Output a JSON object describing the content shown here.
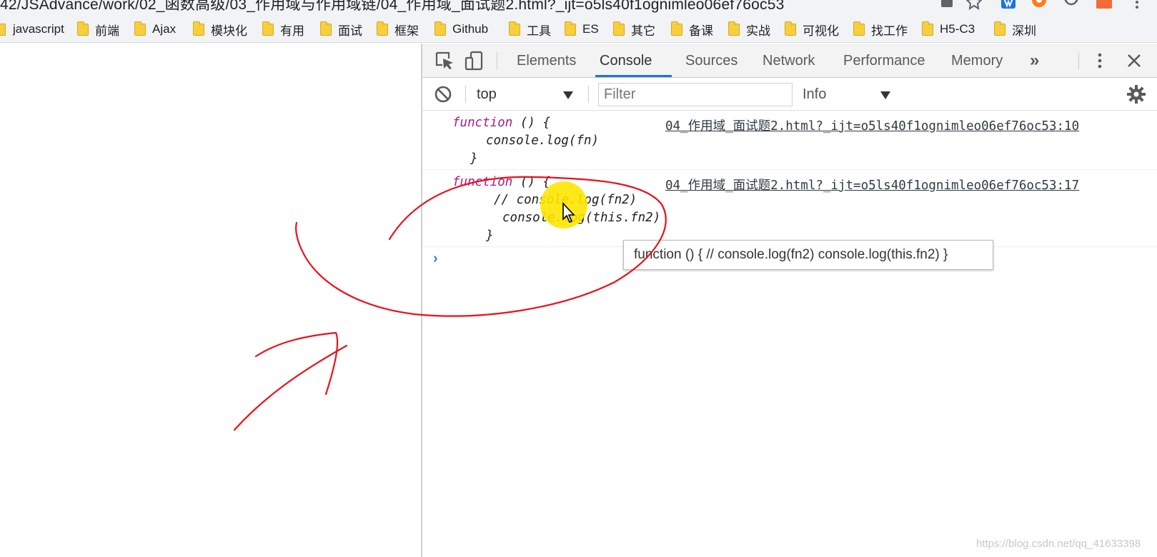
{
  "browser": {
    "url_visible": "42/JSAdvance/work/02_函数高级/03_作用域与作用域链/04_作用域_面试题2.html?_ijt=o5ls40f1ognimleo06ef76oc53"
  },
  "bookmarks": [
    {
      "label": "javascript",
      "folder": false
    },
    {
      "label": "前端",
      "folder": true
    },
    {
      "label": "Ajax",
      "folder": true
    },
    {
      "label": "模块化",
      "folder": true
    },
    {
      "label": "有用",
      "folder": true
    },
    {
      "label": "面试",
      "folder": true
    },
    {
      "label": "框架",
      "folder": true
    },
    {
      "label": "Github",
      "folder": true
    },
    {
      "label": "工具",
      "folder": true
    },
    {
      "label": "ES",
      "folder": true
    },
    {
      "label": "其它",
      "folder": true
    },
    {
      "label": "备课",
      "folder": true
    },
    {
      "label": "实战",
      "folder": true
    },
    {
      "label": "可视化",
      "folder": true
    },
    {
      "label": "找工作",
      "folder": true
    },
    {
      "label": "H5-C3",
      "folder": true
    },
    {
      "label": "深圳",
      "folder": true
    }
  ],
  "devtools": {
    "tabs": [
      "Elements",
      "Console",
      "Sources",
      "Network",
      "Performance",
      "Memory"
    ],
    "active_tab": "Console",
    "more_tabs_glyph": "»",
    "close_glyph": "✕",
    "accent_color": "#1a73e8"
  },
  "console_toolbar": {
    "context": "top",
    "filter_placeholder": "Filter",
    "level": "Info"
  },
  "console_messages": [
    {
      "source": "04_作用域_面试题2.html?_ijt=o5ls40f1ognimleo06ef76oc53:10",
      "line1_keyword": "function",
      "line1_rest": " () {",
      "line2": "console.log(fn)",
      "line3": "}"
    },
    {
      "source": "04_作用域_面试题2.html?_ijt=o5ls40f1ognimleo06ef76oc53:17",
      "line1_keyword": "function",
      "line1_rest": " () {",
      "line2": "// console.log(fn2)",
      "line3": "console.log(this.fn2)",
      "line4": "}"
    }
  ],
  "prompt_glyph": "›",
  "tooltip": "function () { // console.log(fn2) console.log(this.fn2) }",
  "watermark": "https://blog.csdn.net/qq_41633398",
  "colors": {
    "keyword": "#a71d8d",
    "annotation_ink": "#e8121b",
    "cursor_highlight": "#ffe600",
    "prompt": "#367cf1"
  }
}
